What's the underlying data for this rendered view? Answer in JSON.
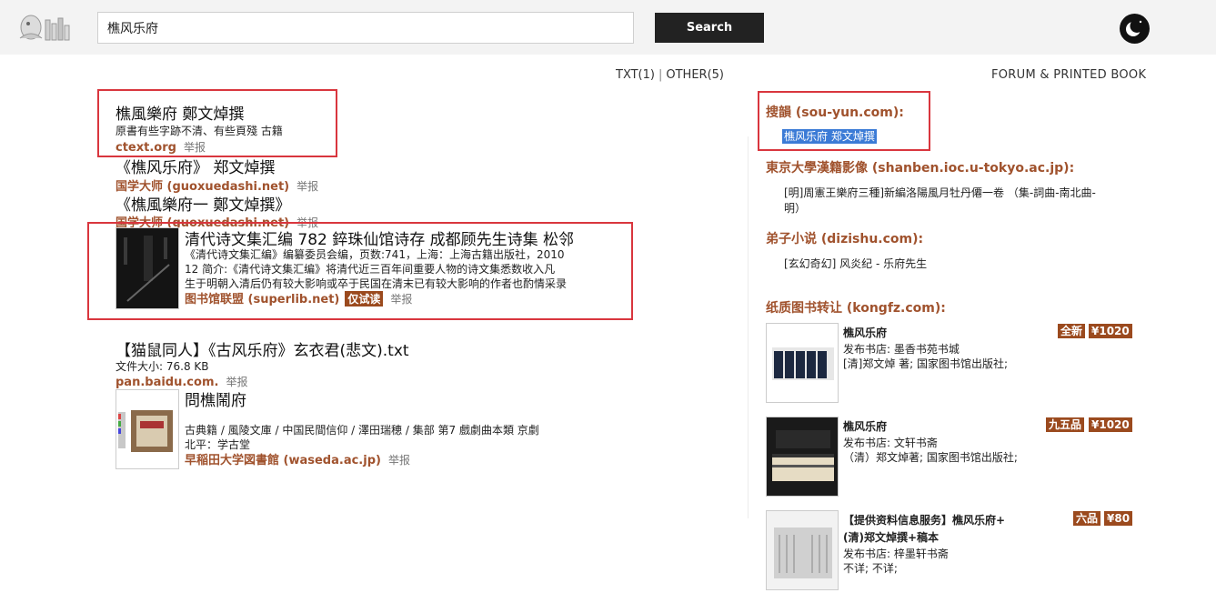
{
  "search": {
    "query": "樵风乐府",
    "button_label": "Search"
  },
  "counts": {
    "txt": "TXT(1)",
    "sep": "|",
    "other": "OTHER(5)"
  },
  "forum_label": "FORUM & PRINTED BOOK",
  "results": [
    {
      "title": "樵風樂府 鄭文焯撰",
      "desc": "原書有些字跡不清、有些頁殘 古籍",
      "source": "ctext.org",
      "report": "举报"
    },
    {
      "title": "《樵风乐府》 郑文焯撰",
      "source": "国学大师 (guoxuedashi.net)",
      "report": "举报"
    },
    {
      "title": "《樵風樂府一 鄭文焯撰》",
      "source": "国学大师 (guoxuedashi.net)",
      "report": "举报"
    },
    {
      "title": "清代诗文集汇编 782 錊珠仙馆诗存 成都顾先生诗集 松邻",
      "desc_lines": [
        "《清代诗文集汇编》编纂委员会编，页数:741，上海：上海古籍出版社，2010",
        "12  简介:《清代诗文集汇编》将清代近三百年间重要人物的诗文集悉数收入凡",
        "生于明朝入清后仍有较大影响或卒于民国在清末已有较大影响的作者也酌情采录"
      ],
      "source": "图书馆联盟 (superlib.net)",
      "tag": "仅试读",
      "report": "举报"
    },
    {
      "title": "【猫鼠同人】《古风乐府》玄衣君(悲文).txt",
      "desc": "文件大小: 76.8 KB",
      "source": "pan.baidu.com.",
      "report": "举报"
    },
    {
      "title": "問樵鬧府",
      "desc_lines": [
        "古典籍 / 風陵文庫 / 中国民間信仰 / 澤田瑞穂 / 集部 第7 戲劇曲本類 京劇",
        "北平：学古堂"
      ],
      "source": "早稲田大学図書館 (waseda.ac.jp)",
      "report": "举报"
    }
  ],
  "sidebar": {
    "souyun": {
      "head": "搜韻 (sou-yun.com):",
      "item": "樵风乐府 郑文焯撰"
    },
    "tokyo": {
      "head": "東京大學漢籍影像 (shanben.ioc.u-tokyo.ac.jp):",
      "line1": "[明]周憲王樂府三種]新編洛陽風月牡丹僊一卷 （集-詞曲-南北曲-",
      "line2": "明）"
    },
    "dizishu": {
      "head": "弟子小说 (dizishu.com):",
      "item": "[玄幻奇幻] 风炎纪 - 乐府先生"
    },
    "kongfz": {
      "head": "纸质图书转让 (kongfz.com):",
      "books": [
        {
          "title": "樵风乐府",
          "shop": "发布书店: 墨香书苑书城",
          "author": "[清]郑文焯 著; 国家图书馆出版社;",
          "cond": "全新",
          "price": "¥1020"
        },
        {
          "title": "樵风乐府",
          "shop": "发布书店: 文轩书斋",
          "author": "（清）郑文焯著; 国家图书馆出版社;",
          "cond": "九五品",
          "price": "¥1020"
        },
        {
          "title": "【提供资料信息服务】樵风乐府+",
          "title2": "(清)郑文焯撰+稿本",
          "shop": "发布书店: 梓墨轩书斋",
          "author": "不详; 不详;",
          "cond": "六品",
          "price": "¥80"
        }
      ]
    }
  },
  "colors": {
    "accent": "#a0522d",
    "highlight_box": "#d9363e",
    "badge": "#9b4a1e",
    "selection": "#3b7bd6"
  }
}
